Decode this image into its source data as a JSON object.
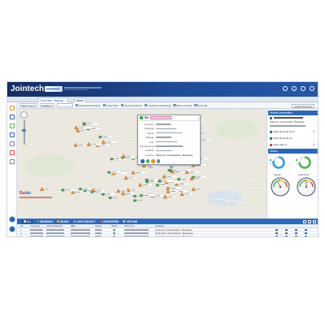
{
  "colors": {
    "header_dark": "#142d60",
    "accent": "#1f5fb4",
    "marker_orange": "#f0901f",
    "marker_green": "#3aa84a",
    "map_bg": "#ebe8e0"
  },
  "header": {
    "logo": "Jointech",
    "icons": [
      "user-icon",
      "message-icon",
      "settings-icon",
      "logout-icon"
    ]
  },
  "tabs": [
    {
      "label": "Real-time Tracking",
      "active": true
    },
    {
      "label": "Alarm",
      "active": false
    }
  ],
  "toolbar": {
    "map_type": "Basic map",
    "layer": "Satellite",
    "search_placeholder": "",
    "items": [
      "Rectangular Search",
      "Draw Point",
      "Show Geofence",
      "Geofence Monitoring",
      "Route Control",
      "Full map"
    ],
    "right": "Vehicle Running"
  },
  "nav": {
    "icons": [
      "home-icon",
      "location-icon",
      "car-icon",
      "list-icon",
      "report-icon",
      "alarm-icon",
      "settings-icon"
    ],
    "bottom_icons": [
      "arrow-icon",
      "globe-icon"
    ]
  },
  "map": {
    "logo_part1": "Bai",
    "logo_part2": "du"
  },
  "popup": {
    "title": "Rb",
    "fields": [
      {
        "label": "Company:"
      },
      {
        "label": "Message:"
      },
      {
        "label": "Speed:"
      },
      {
        "label": "Mileage:"
      },
      {
        "label": "Fuel:"
      },
      {
        "label": "Remaining fuel:"
      },
      {
        "label": "Updated:"
      },
      {
        "label": "Location:",
        "value": "Gaborone, South Eastern, Botswana"
      }
    ]
  },
  "panel": {
    "vehicle_header": "Vehicle Information",
    "address": "Gaborone, South Eastern, Botswana",
    "stats": [
      {
        "label": "Daily Running (Km)",
        "value": "1"
      },
      {
        "label": "Daily Running (h)",
        "value": ""
      },
      {
        "label": "Daily Alarms",
        "value": "1"
      }
    ],
    "status_header": "Status",
    "rings": [
      {
        "fill": 0.8,
        "color": "#2fa0d8"
      },
      {
        "fill": 0.75,
        "color": "#4cb848"
      }
    ],
    "gauges": [
      {
        "label": "Signal",
        "level": 0.35
      },
      {
        "label": "Total Fuel",
        "level": 0.5
      }
    ]
  },
  "table": {
    "tabs": [
      {
        "label": "ALL",
        "color": "#ffffff",
        "active": true
      },
      {
        "label": "WORKING",
        "color": "#4cb848"
      },
      {
        "label": "IDLING",
        "color": "#f0c419"
      },
      {
        "label": "LOSTCONTACT",
        "color": "#9aa3ae"
      },
      {
        "label": "OVERSPEED",
        "color": "#e04a3a"
      },
      {
        "label": "OFFLINE",
        "color": "#c7ced8"
      }
    ],
    "headers": [
      "No.",
      "Company",
      "Vehicle Plate/ID",
      "IMEI",
      "Speed",
      "Status",
      "GPS Time",
      "Location"
    ],
    "rows": [
      {
        "no": "1",
        "location": "Gaborone, South Eastern, Botswana"
      },
      {
        "no": "2",
        "location": "North East, South Eastern, Botswana"
      },
      {
        "no": "3",
        "location": "Gaborone, South Eastern, Botswana"
      }
    ]
  }
}
